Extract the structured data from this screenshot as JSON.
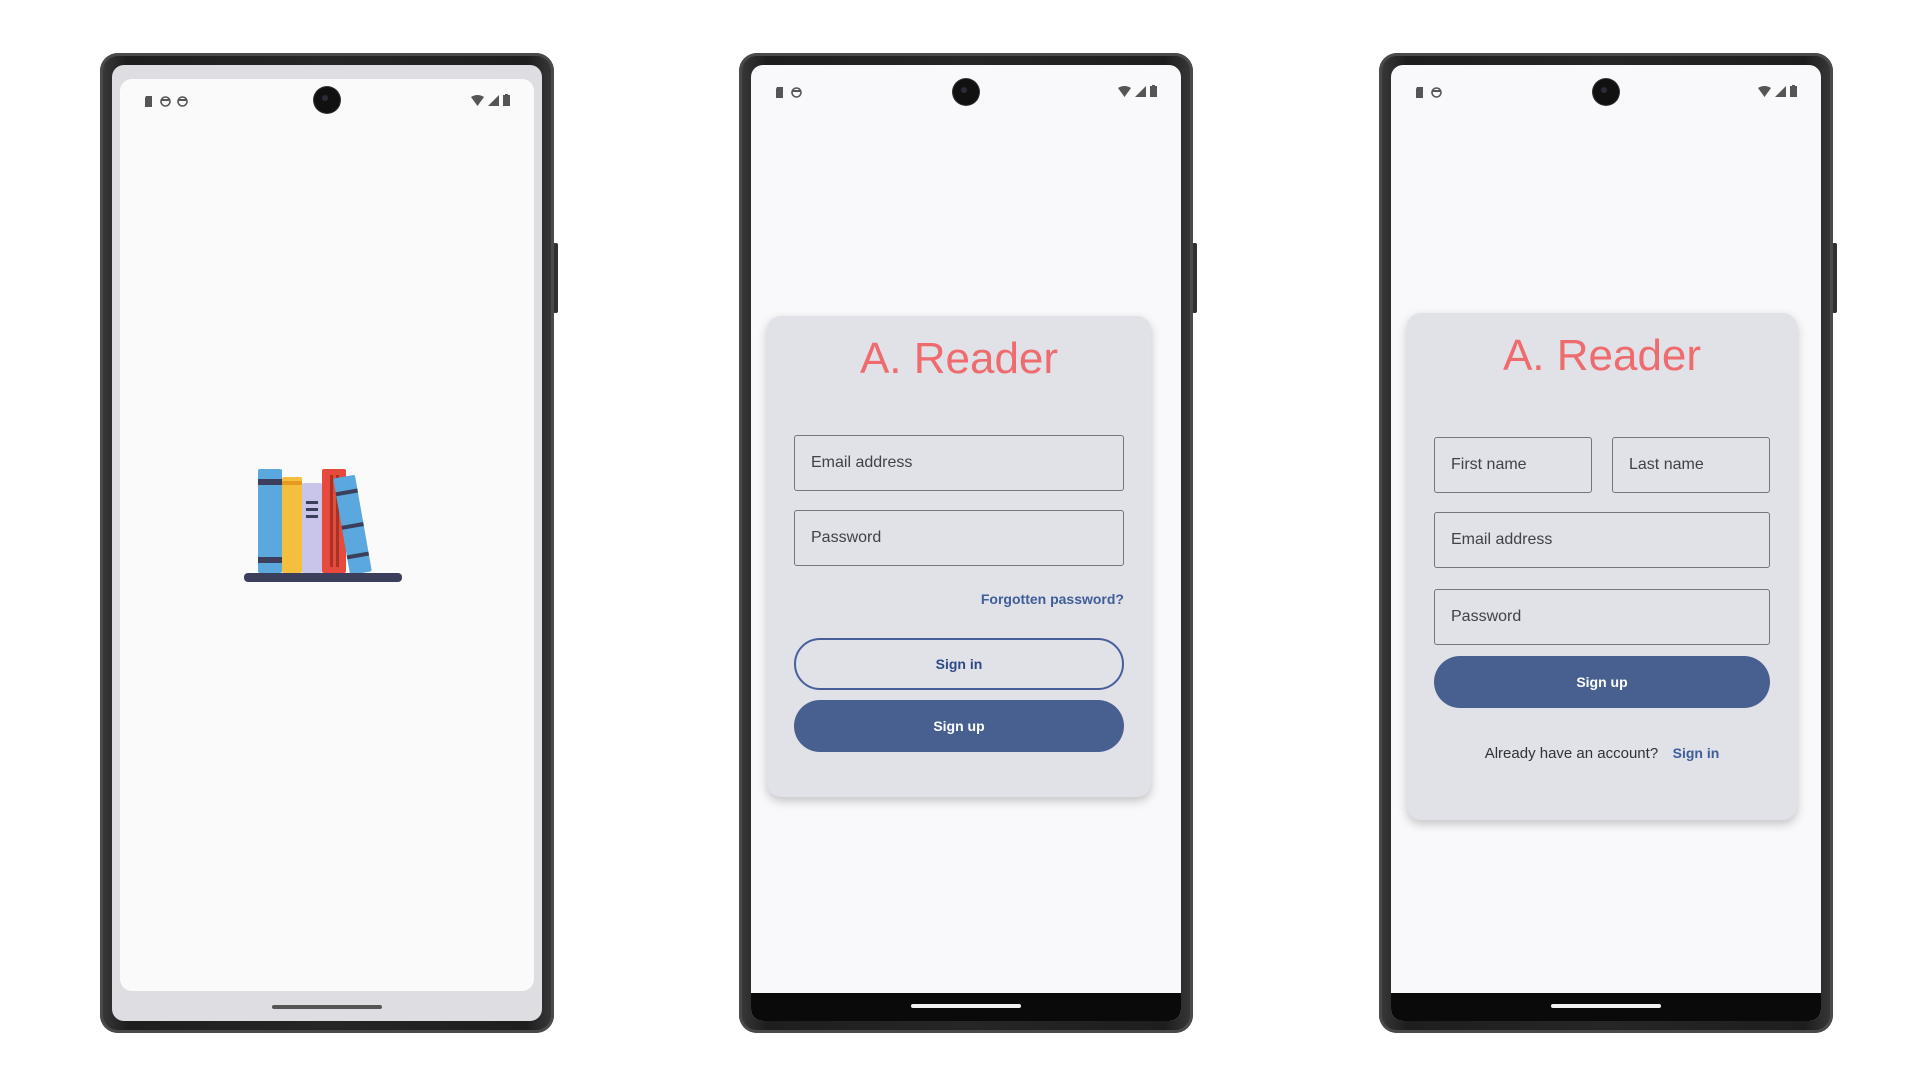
{
  "splash": {
    "logo": "bookshelf-logo",
    "book_colors": [
      "#5aa8de",
      "#f4bf3c",
      "#c9c5ea",
      "#e64a3c",
      "#5aa8de"
    ],
    "shelf_color": "#3b3f5c"
  },
  "status_bar": {
    "left_icons": [
      "sd-card-icon",
      "shield-icon",
      "shield-icon"
    ],
    "right_icons": [
      "wifi-icon",
      "signal-icon",
      "battery-icon"
    ]
  },
  "sign_in_screen": {
    "title": "A. Reader",
    "email_placeholder": "Email address",
    "password_placeholder": "Password",
    "forgot_link": "Forgotten password?",
    "sign_in_button": "Sign in",
    "sign_up_button": "Sign up"
  },
  "sign_up_screen": {
    "title": "A. Reader",
    "first_name_placeholder": "First name",
    "last_name_placeholder": "Last name",
    "email_placeholder": "Email address",
    "password_placeholder": "Password",
    "sign_up_button": "Sign up",
    "have_account_text": "Already have an account?",
    "sign_in_link": "Sign in"
  },
  "colors": {
    "title": "#ee6b6e",
    "primary": "#48608f",
    "card": "#e1e1e8",
    "link": "#3f5d98"
  }
}
